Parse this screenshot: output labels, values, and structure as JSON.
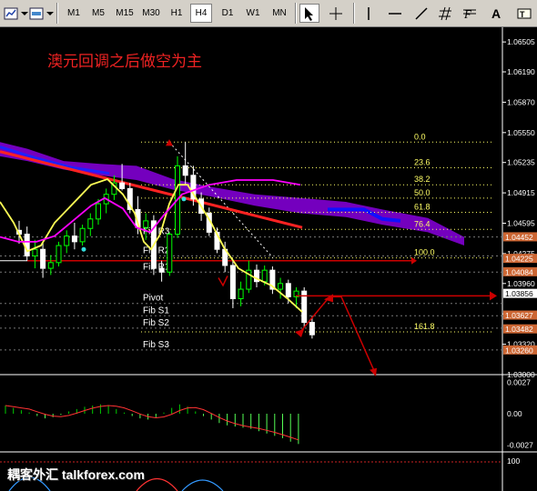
{
  "toolbar": {
    "timeframes": [
      "M1",
      "M5",
      "M15",
      "M30",
      "H1",
      "H4",
      "D1",
      "W1",
      "MN"
    ],
    "active": "H4",
    "icons": [
      "chart-type-icon",
      "zoom-dropdown-icon",
      "cursor-icon",
      "crosshair-icon",
      "vertical-line-icon",
      "horizontal-line-icon",
      "trendline-icon",
      "hash-icon",
      "fib-icon",
      "text-icon",
      "label-icon"
    ],
    "text_tool": "A"
  },
  "annotation": "澳元回调之后做空为主",
  "watermark": "耦客外汇 talkforex.com",
  "colors": {
    "bull_candle": "#00ff00",
    "bear_candle": "#ffffff",
    "ma_fast": "#ffff55",
    "ma_slow": "#ff00ff",
    "trend_line": "#ff2222",
    "cloud": "#7a00c8",
    "pivot_line": "#cc0000",
    "grid": "#777777",
    "label_bg": "#cc6633"
  },
  "price_axis": {
    "ticks": [
      "1.06505",
      "1.06190",
      "1.05870",
      "1.05550",
      "1.05235",
      "1.04915",
      "1.04595",
      "1.04275",
      "1.03960",
      "1.03640",
      "1.03320",
      "1.03000"
    ],
    "highlight_labels": [
      "1.04452",
      "1.04225",
      "1.04084",
      "1.03856",
      "1.03627",
      "1.03482",
      "1.03260"
    ]
  },
  "osc_axis": {
    "ticks": [
      "0.0027",
      "0.00",
      "-0.0027"
    ]
  },
  "bottom_axis": {
    "ticks": [
      "100"
    ]
  },
  "pivot_labels": [
    "Fib R3",
    "Fib R2",
    "Fib R1",
    "Pivot",
    "Fib S1",
    "Fib S2",
    "Fib S3"
  ],
  "fib_labels": [
    "0.0",
    "23.6",
    "38.2",
    "50.0",
    "61.8",
    "76.4",
    "100.0",
    "161.8"
  ],
  "chart_data": {
    "type": "candlestick",
    "ylim": [
      1.03,
      1.0665
    ],
    "candles": [
      {
        "o": 1.0452,
        "h": 1.0462,
        "l": 1.0438,
        "c": 1.0448
      },
      {
        "o": 1.0448,
        "h": 1.0456,
        "l": 1.042,
        "c": 1.0425
      },
      {
        "o": 1.0425,
        "h": 1.0442,
        "l": 1.0412,
        "c": 1.0432
      },
      {
        "o": 1.0432,
        "h": 1.044,
        "l": 1.0402,
        "c": 1.0412
      },
      {
        "o": 1.0412,
        "h": 1.0426,
        "l": 1.0405,
        "c": 1.0418
      },
      {
        "o": 1.0418,
        "h": 1.044,
        "l": 1.0414,
        "c": 1.0436
      },
      {
        "o": 1.0436,
        "h": 1.0452,
        "l": 1.0428,
        "c": 1.0446
      },
      {
        "o": 1.0446,
        "h": 1.046,
        "l": 1.0432,
        "c": 1.044
      },
      {
        "o": 1.044,
        "h": 1.0458,
        "l": 1.0436,
        "c": 1.0454
      },
      {
        "o": 1.0454,
        "h": 1.047,
        "l": 1.0446,
        "c": 1.0464
      },
      {
        "o": 1.0464,
        "h": 1.0485,
        "l": 1.0458,
        "c": 1.048
      },
      {
        "o": 1.048,
        "h": 1.0496,
        "l": 1.047,
        "c": 1.049
      },
      {
        "o": 1.049,
        "h": 1.051,
        "l": 1.0484,
        "c": 1.0502
      },
      {
        "o": 1.0502,
        "h": 1.0522,
        "l": 1.0494,
        "c": 1.0496
      },
      {
        "o": 1.0496,
        "h": 1.0502,
        "l": 1.047,
        "c": 1.0474
      },
      {
        "o": 1.0474,
        "h": 1.0488,
        "l": 1.0448,
        "c": 1.0455
      },
      {
        "o": 1.0455,
        "h": 1.047,
        "l": 1.0442,
        "c": 1.0462
      },
      {
        "o": 1.0462,
        "h": 1.0468,
        "l": 1.0405,
        "c": 1.0412
      },
      {
        "o": 1.0412,
        "h": 1.042,
        "l": 1.0398,
        "c": 1.0408
      },
      {
        "o": 1.0408,
        "h": 1.045,
        "l": 1.0404,
        "c": 1.0448
      },
      {
        "o": 1.0448,
        "h": 1.053,
        "l": 1.0444,
        "c": 1.052
      },
      {
        "o": 1.052,
        "h": 1.0545,
        "l": 1.05,
        "c": 1.051
      },
      {
        "o": 1.051,
        "h": 1.052,
        "l": 1.0478,
        "c": 1.0485
      },
      {
        "o": 1.0485,
        "h": 1.0492,
        "l": 1.0462,
        "c": 1.047
      },
      {
        "o": 1.047,
        "h": 1.0476,
        "l": 1.0446,
        "c": 1.045
      },
      {
        "o": 1.045,
        "h": 1.0455,
        "l": 1.0428,
        "c": 1.0432
      },
      {
        "o": 1.0432,
        "h": 1.044,
        "l": 1.0408,
        "c": 1.0415
      },
      {
        "o": 1.0415,
        "h": 1.042,
        "l": 1.037,
        "c": 1.038
      },
      {
        "o": 1.038,
        "h": 1.0398,
        "l": 1.0372,
        "c": 1.039
      },
      {
        "o": 1.039,
        "h": 1.042,
        "l": 1.0386,
        "c": 1.041
      },
      {
        "o": 1.041,
        "h": 1.0416,
        "l": 1.0392,
        "c": 1.0398
      },
      {
        "o": 1.0398,
        "h": 1.0415,
        "l": 1.0394,
        "c": 1.041
      },
      {
        "o": 1.041,
        "h": 1.0414,
        "l": 1.0385,
        "c": 1.039
      },
      {
        "o": 1.039,
        "h": 1.0402,
        "l": 1.038,
        "c": 1.0396
      },
      {
        "o": 1.0396,
        "h": 1.04,
        "l": 1.0375,
        "c": 1.0382
      },
      {
        "o": 1.0382,
        "h": 1.0392,
        "l": 1.037,
        "c": 1.0388
      },
      {
        "o": 1.0388,
        "h": 1.0392,
        "l": 1.035,
        "c": 1.0355
      },
      {
        "o": 1.0355,
        "h": 1.0362,
        "l": 1.0338,
        "c": 1.0342
      }
    ],
    "pivot_levels": [
      1.0445,
      1.0425,
      1.0408,
      1.0375,
      1.0362,
      1.0349,
      1.0326
    ],
    "current_price": 1.03856,
    "fib_levels": [
      {
        "label": "0.0",
        "price": 1.0545
      },
      {
        "label": "23.6",
        "price": 1.0518
      },
      {
        "label": "38.2",
        "price": 1.05
      },
      {
        "label": "50.0",
        "price": 1.0486
      },
      {
        "label": "61.8",
        "price": 1.0471
      },
      {
        "label": "76.4",
        "price": 1.0453
      },
      {
        "label": "100.0",
        "price": 1.0423
      },
      {
        "label": "161.8",
        "price": 1.0345
      }
    ],
    "oscillator": [
      0.0007,
      0.0005,
      0.0003,
      0.0001,
      -0.0002,
      -0.0004,
      -0.0003,
      -0.0001,
      0.0002,
      0.0004,
      0.0006,
      0.0007,
      0.0008,
      0.0007,
      0.0004,
      0.0001,
      -0.0002,
      -0.0004,
      -0.0005,
      -0.0003,
      0.0001,
      0.0005,
      0.0008,
      0.0006,
      0.0002,
      -0.0002,
      -0.0005,
      -0.0008,
      -0.001,
      -0.0011,
      -0.0012,
      -0.0013,
      -0.0015,
      -0.0017,
      -0.0019,
      -0.0021,
      -0.0024,
      -0.0026
    ],
    "osc_ylim": [
      -0.0032,
      0.0032
    ]
  }
}
